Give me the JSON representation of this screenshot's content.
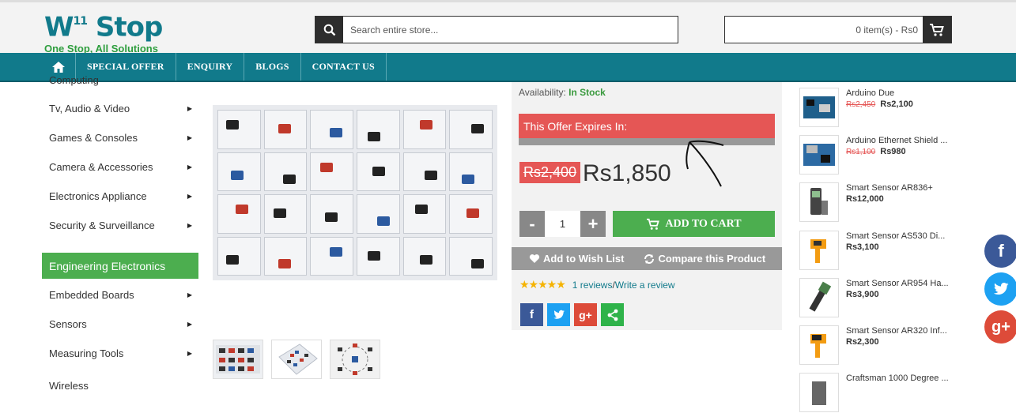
{
  "header": {
    "logo_main": "W",
    "logo_sup": "11",
    "logo_word": "Stop",
    "logo_tagline": "One Stop, All Solutions",
    "search_placeholder": "Search entire store...",
    "cart_text": "0 item(s) - Rs0"
  },
  "nav": {
    "items": [
      {
        "label": "SPECIAL OFFER"
      },
      {
        "label": "ENQUIRY"
      },
      {
        "label": "BLOGS"
      },
      {
        "label": "CONTACT US"
      }
    ]
  },
  "sidebar": {
    "partial_top": "Computing",
    "items": [
      {
        "label": "Tv, Audio & Video"
      },
      {
        "label": "Games & Consoles"
      },
      {
        "label": "Camera & Accessories"
      },
      {
        "label": "Electronics Appliance"
      },
      {
        "label": "Security & Surveillance"
      }
    ],
    "section_heading": "Engineering Electronics",
    "section_items": [
      {
        "label": "Embedded Boards"
      },
      {
        "label": "Sensors"
      },
      {
        "label": "Measuring Tools"
      }
    ],
    "partial_bottom": "Wireless"
  },
  "product": {
    "availability_label": "Availability:",
    "availability_value": "In Stock",
    "offer_text": "This Offer Expires In:",
    "old_price": "Rs2,400",
    "new_price": "Rs1,850",
    "qty_minus": "-",
    "qty_value": "1",
    "qty_plus": "+",
    "add_to_cart": "ADD TO CART",
    "wishlist": "Add to Wish List",
    "compare": "Compare this Product",
    "stars": "★★★★★",
    "reviews_link": "1 reviews",
    "reviews_sep": " / ",
    "write_review": "Write a review"
  },
  "related": [
    {
      "name": "Arduino Due",
      "old": "Rs2,450",
      "price": "Rs2,100"
    },
    {
      "name": "Arduino Ethernet Shield ...",
      "old": "Rs1,100",
      "price": "Rs980"
    },
    {
      "name": "Smart Sensor AR836+",
      "old": "",
      "price": "Rs12,000"
    },
    {
      "name": "Smart Sensor AS530 Di...",
      "old": "",
      "price": "Rs3,100"
    },
    {
      "name": "Smart Sensor AR954 Ha...",
      "old": "",
      "price": "Rs3,900"
    },
    {
      "name": "Smart Sensor AR320 Inf...",
      "old": "",
      "price": "Rs2,300"
    },
    {
      "name": "Craftsman 1000 Degree ...",
      "old": "",
      "price": ""
    }
  ],
  "colors": {
    "brand_teal": "#117a8b",
    "accent_green": "#4cae4f",
    "offer_red": "#e55655",
    "facebook": "#3b5998",
    "twitter": "#1da1f2",
    "google": "#dd4b39"
  }
}
